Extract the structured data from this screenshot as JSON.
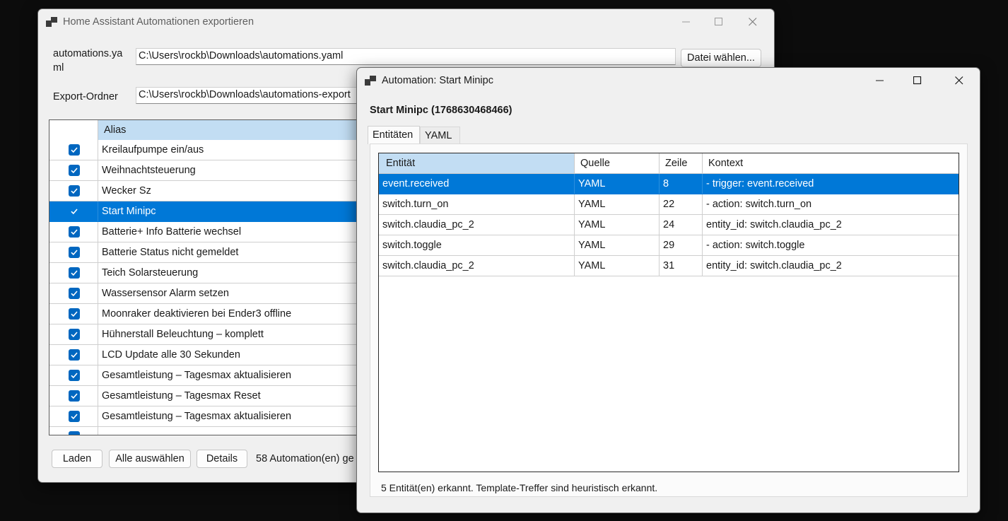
{
  "main_window": {
    "title": "Home Assistant Automationen exportieren",
    "yaml_label": "automations.yaml",
    "yaml_path": "C:\\Users\\rockb\\Downloads\\automations.yaml",
    "choose_file_button": "Datei wählen...",
    "export_label": "Export-Ordner",
    "export_path": "C:\\Users\\rockb\\Downloads\\automations-export",
    "grid_header_alias": "Alias",
    "rows": [
      {
        "alias": "Kreilaufpumpe ein/aus",
        "checked": true
      },
      {
        "alias": "Weihnachtsteuerung",
        "checked": true
      },
      {
        "alias": "Wecker Sz",
        "checked": true
      },
      {
        "alias": "Start Minipc",
        "checked": true,
        "selected": true
      },
      {
        "alias": "Batterie+ Info Batterie wechsel",
        "checked": true
      },
      {
        "alias": "Batterie Status nicht gemeldet",
        "checked": true
      },
      {
        "alias": "Teich Solarsteuerung",
        "checked": true
      },
      {
        "alias": "Wassersensor Alarm setzen",
        "checked": true
      },
      {
        "alias": "Moonraker deaktivieren bei Ender3 offline",
        "checked": true
      },
      {
        "alias": "Hühnerstall Beleuchtung – komplett",
        "checked": true
      },
      {
        "alias": "LCD Update alle 30 Sekunden",
        "checked": true
      },
      {
        "alias": "Gesamtleistung – Tagesmax aktualisieren",
        "checked": true
      },
      {
        "alias": "Gesamtleistung – Tagesmax Reset",
        "checked": true
      },
      {
        "alias": "Gesamtleistung – Tagesmax aktualisieren",
        "checked": true
      }
    ],
    "buttons": {
      "load": "Laden",
      "select_all": "Alle auswählen",
      "details": "Details"
    },
    "status": "58 Automation(en) ge"
  },
  "detail_window": {
    "title": "Automation: Start Minipc",
    "heading": "Start Minipc (1768630468466)",
    "tabs": [
      {
        "label": "Entitäten",
        "active": true
      },
      {
        "label": "YAML",
        "active": false
      }
    ],
    "columns": [
      "Entität",
      "Quelle",
      "Zeile",
      "Kontext"
    ],
    "rows": [
      {
        "entity": "event.received",
        "source": "YAML",
        "line": "8",
        "context": "- trigger: event.received",
        "selected": true
      },
      {
        "entity": "switch.turn_on",
        "source": "YAML",
        "line": "22",
        "context": "- action: switch.turn_on"
      },
      {
        "entity": "switch.claudia_pc_2",
        "source": "YAML",
        "line": "24",
        "context": "entity_id: switch.claudia_pc_2"
      },
      {
        "entity": "switch.toggle",
        "source": "YAML",
        "line": "29",
        "context": "- action: switch.toggle"
      },
      {
        "entity": "switch.claudia_pc_2",
        "source": "YAML",
        "line": "31",
        "context": "entity_id: switch.claudia_pc_2"
      }
    ],
    "status": "5 Entität(en) erkannt. Template-Treffer sind heuristisch erkannt."
  },
  "colors": {
    "selection": "#0078d7",
    "header_highlight": "#c2ddf3",
    "checkbox": "#0067c0"
  }
}
